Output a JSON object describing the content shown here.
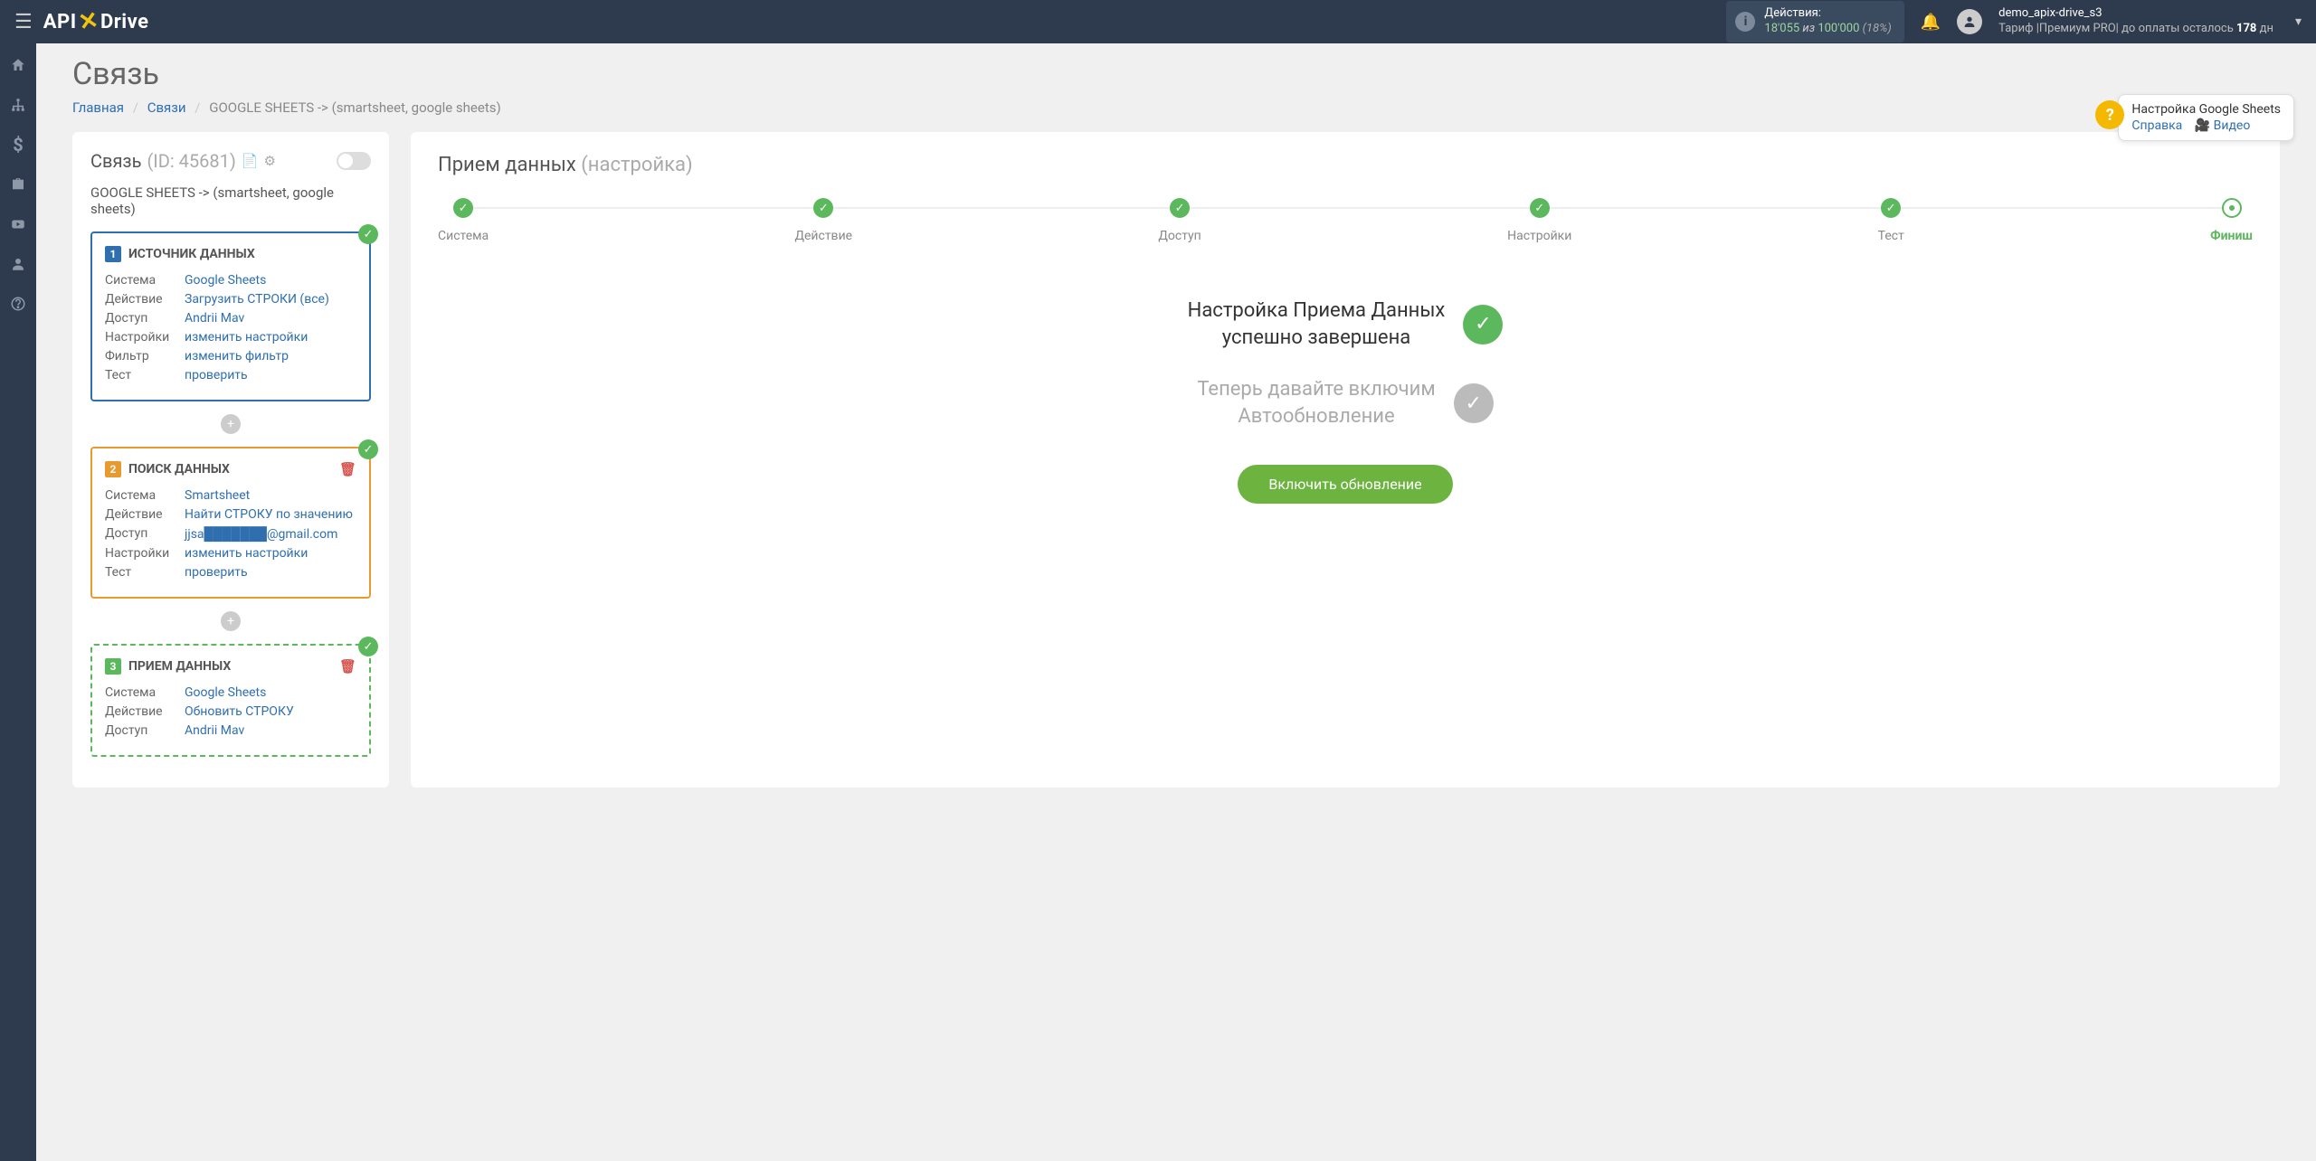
{
  "top": {
    "logo1": "API",
    "logo2": "Drive",
    "actions_label": "Действия:",
    "actions_used": "18'055",
    "actions_of": " из ",
    "actions_total": "100'000",
    "actions_pct": " (18%)",
    "user": "demo_apix-drive_s3",
    "tariff": "Тариф |Премиум PRO| до оплаты осталось ",
    "days": "178",
    "days_suffix": " дн"
  },
  "page": {
    "title": "Связь",
    "bc_home": "Главная",
    "bc_links": "Связи",
    "bc_current": "GOOGLE SHEETS -> (smartsheet, google sheets)"
  },
  "help": {
    "title": "Настройка Google Sheets",
    "ref": "Справка",
    "video": "Видео"
  },
  "left": {
    "title": "Связь",
    "id": "(ID: 45681)",
    "sub": "GOOGLE SHEETS -> (smartsheet, google sheets)",
    "labels": {
      "system": "Система",
      "action": "Действие",
      "access": "Доступ",
      "settings": "Настройки",
      "filter": "Фильтр",
      "test": "Тест"
    },
    "c1": {
      "num": "1",
      "title": "ИСТОЧНИК ДАННЫХ",
      "system": "Google Sheets",
      "action": "Загрузить СТРОКИ (все)",
      "access": "Andrii Mav",
      "settings": "изменить настройки",
      "filter": "изменить фильтр",
      "test": "проверить"
    },
    "c2": {
      "num": "2",
      "title": "ПОИСК ДАННЫХ",
      "system": "Smartsheet",
      "action": "Найти СТРОКУ по значению",
      "access": "jjsa███████@gmail.com",
      "settings": "изменить настройки",
      "test": "проверить"
    },
    "c3": {
      "num": "3",
      "title": "ПРИЕМ ДАННЫХ",
      "system": "Google Sheets",
      "action": "Обновить СТРОКУ",
      "access": "Andrii Mav"
    }
  },
  "right": {
    "title": "Прием данных ",
    "title_sub": "(настройка)",
    "steps": [
      "Система",
      "Действие",
      "Доступ",
      "Настройки",
      "Тест",
      "Финиш"
    ],
    "msg1a": "Настройка Приема Данных",
    "msg1b": "успешно завершена",
    "msg2a": "Теперь давайте включим",
    "msg2b": "Автообновление",
    "btn": "Включить обновление"
  }
}
